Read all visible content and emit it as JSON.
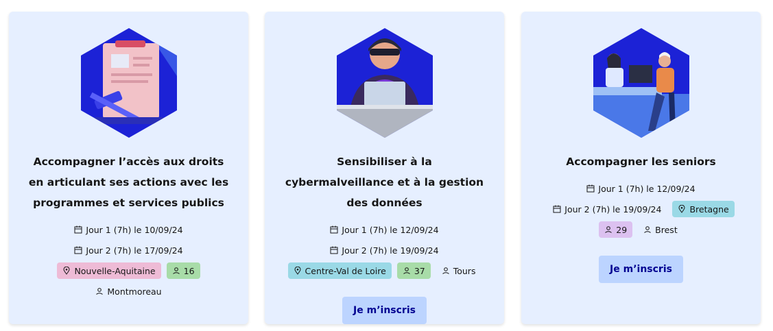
{
  "cards": [
    {
      "title": "Accompagner l’accès aux droits en articulant ses actions avec les programmes et services publics",
      "day1": "Jour 1 (7h) le 10/09/24",
      "day2": "Jour 2 (7h) le 17/09/24",
      "region": "Nouvelle-Aquitaine",
      "seats": "16",
      "city": "Montmoreau",
      "image_icon": "justice-clipboard-gavel-illustration"
    },
    {
      "title": "Sensibiliser à la cybermalveillance et à la gestion des données",
      "day1": "Jour 1 (7h) le 12/09/24",
      "day2": "Jour 2 (7h) le 19/09/24",
      "region": "Centre-Val de Loire",
      "seats": "37",
      "city": "Tours",
      "button": "Je m’inscris",
      "image_icon": "hacker-laptop-illustration"
    },
    {
      "title": "Accompagner les seniors",
      "day1": "Jour 1 (7h) le 12/09/24",
      "day2": "Jour 2 (7h) le 19/09/24",
      "region": "Bretagne",
      "seats": "29",
      "city": "Brest",
      "button": "Je m’inscris",
      "image_icon": "senior-counter-illustration"
    }
  ],
  "colors": {
    "card_bg": "#e6efff",
    "hex_blue": "#1f1fd1",
    "button_bg": "#bcd4ff",
    "button_text": "#000091",
    "region_teal": "#9ad9e6",
    "region_pink": "#eebbd6",
    "count_green": "#a8dca8",
    "count_purple": "#dcc1f0"
  }
}
